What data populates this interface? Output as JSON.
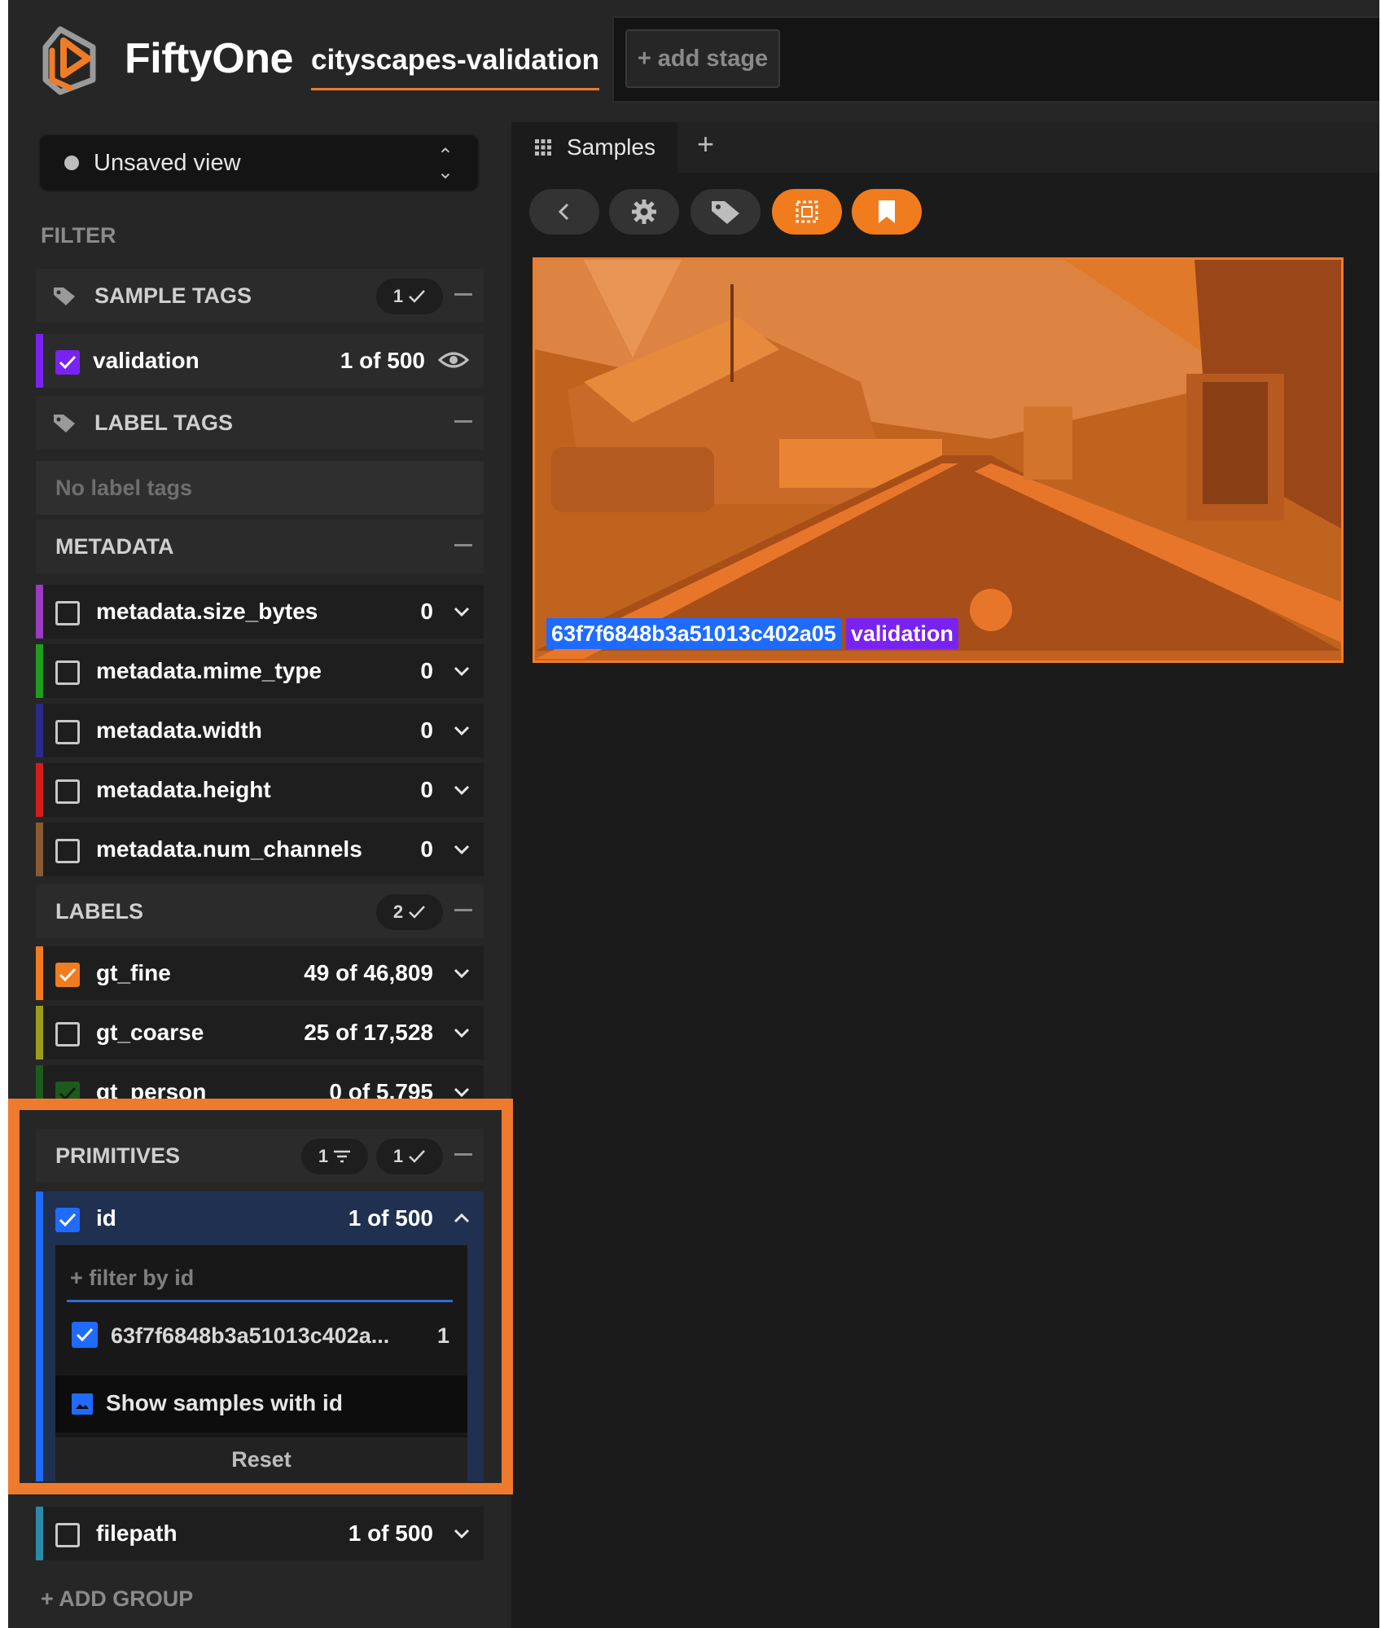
{
  "header": {
    "app_title": "FiftyOne",
    "dataset_name": "cityscapes-validation",
    "add_stage_label": "+ add stage"
  },
  "sidebar": {
    "view_selector": "Unsaved view",
    "filter_heading": "FILTER",
    "sample_tags": {
      "label": "SAMPLE TAGS",
      "selected_count": "1",
      "items": [
        {
          "name": "validation",
          "count": "1 of 500",
          "checked": true,
          "color": "#7a22f2"
        }
      ]
    },
    "label_tags": {
      "label": "LABEL TAGS",
      "empty_text": "No label tags"
    },
    "metadata": {
      "label": "METADATA",
      "items": [
        {
          "name": "metadata.size_bytes",
          "count": "0",
          "color": "#9b3bc2"
        },
        {
          "name": "metadata.mime_type",
          "count": "0",
          "color": "#1f9d1f"
        },
        {
          "name": "metadata.width",
          "count": "0",
          "color": "#2a2a8c"
        },
        {
          "name": "metadata.height",
          "count": "0",
          "color": "#d41c1c"
        },
        {
          "name": "metadata.num_channels",
          "count": "0",
          "color": "#8a5a32"
        }
      ]
    },
    "labels": {
      "label": "LABELS",
      "selected_count": "2",
      "items": [
        {
          "name": "gt_fine",
          "count": "49 of 46,809",
          "checked": true,
          "color": "#f07c1e"
        },
        {
          "name": "gt_coarse",
          "count": "25 of 17,528",
          "checked": false,
          "color": "#9c9c1a"
        },
        {
          "name": "gt_person",
          "count": "0 of 5,795",
          "checked": true,
          "color": "#1d5a1d"
        }
      ]
    },
    "primitives": {
      "label": "PRIMITIVES",
      "filter_count": "1",
      "selected_count": "1",
      "id_field": {
        "name": "id",
        "count": "1 of 500",
        "filter_placeholder": "+ filter by id",
        "value": "63f7f6848b3a51013c402a...",
        "value_count": "1",
        "show_samples_label": "Show samples with id",
        "reset_label": "Reset"
      },
      "filepath": {
        "name": "filepath",
        "count": "1 of 500"
      }
    },
    "add_group_label": "+ ADD GROUP"
  },
  "main": {
    "tab_label": "Samples",
    "sample": {
      "id_label": "63f7f6848b3a51013c402a05",
      "tag_label": "validation"
    }
  },
  "colors": {
    "accent": "#f07c28",
    "selected_blue": "#1f6bff",
    "tag_purple": "#7a22f2"
  }
}
